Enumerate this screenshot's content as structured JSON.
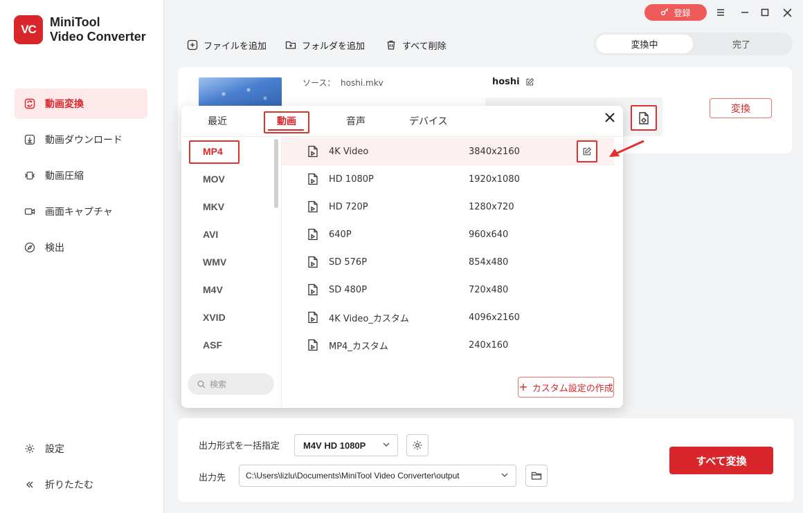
{
  "app": {
    "logo_text": "VC",
    "title_line1": "MiniTool",
    "title_line2": "Video Converter",
    "brand_color": "#d9262b"
  },
  "topbar": {
    "login_label": "登録",
    "login_icon": "key-icon",
    "window_controls": [
      "menu-icon",
      "minimize-icon",
      "maximize-icon",
      "close-icon"
    ]
  },
  "toolbar": {
    "add_file": "ファイルを追加",
    "add_folder": "フォルダを追加",
    "delete_all": "すべて削除"
  },
  "status_tabs": {
    "converting": "変換中",
    "done": "完了"
  },
  "sidebar": {
    "items": [
      {
        "label": "動画変換",
        "icon": "convert-icon",
        "active": true
      },
      {
        "label": "動画ダウンロード",
        "icon": "download-icon"
      },
      {
        "label": "動画圧縮",
        "icon": "compress-icon"
      },
      {
        "label": "画面キャプチャ",
        "icon": "camera-icon"
      },
      {
        "label": "検出",
        "icon": "compass-icon"
      }
    ],
    "settings": "設定",
    "collapse": "折りたたむ"
  },
  "file": {
    "source_prefix": "ソース：",
    "source_name": "hoshi.mkv",
    "target_name": "hoshi",
    "convert_label": "変換"
  },
  "format_panel": {
    "tabs": [
      "最近",
      "動画",
      "音声",
      "デバイス"
    ],
    "active_tab": "動画",
    "formats": [
      "MP4",
      "MOV",
      "MKV",
      "AVI",
      "WMV",
      "M4V",
      "XVID",
      "ASF"
    ],
    "active_format": "MP4",
    "search_placeholder": "検索",
    "presets": [
      {
        "name": "4K Video",
        "resolution": "3840x2160"
      },
      {
        "name": "HD 1080P",
        "resolution": "1920x1080"
      },
      {
        "name": "HD 720P",
        "resolution": "1280x720"
      },
      {
        "name": "640P",
        "resolution": "960x640"
      },
      {
        "name": "SD 576P",
        "resolution": "854x480"
      },
      {
        "name": "SD 480P",
        "resolution": "720x480"
      },
      {
        "name": "4K Video_カスタム",
        "resolution": "4096x2160"
      },
      {
        "name": "MP4_カスタム",
        "resolution": "240x160"
      }
    ],
    "custom_create": "カスタム設定の作成"
  },
  "bottom": {
    "output_format_label": "出力形式を一括指定",
    "output_format_value": "M4V HD 1080P",
    "output_dest_label": "出力先",
    "output_dest_value": "C:\\Users\\lizlu\\Documents\\MiniTool Video Converter\\output",
    "convert_all": "すべて変換"
  }
}
